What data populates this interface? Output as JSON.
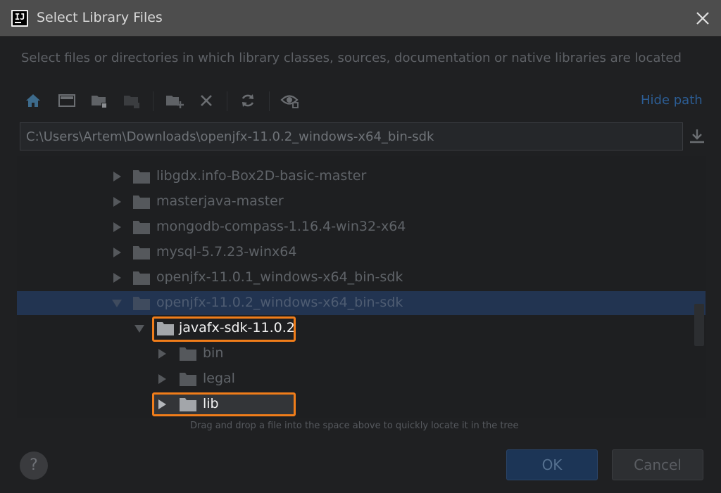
{
  "titlebar": {
    "title": "Select Library Files"
  },
  "description": "Select files or directories in which library classes, sources, documentation or native libraries are located",
  "toolbar": {
    "icons": [
      "home-icon",
      "desktop-icon",
      "project-folder-icon",
      "module-folder-icon",
      "new-folder-icon",
      "delete-icon",
      "refresh-icon",
      "show-hidden-icon"
    ],
    "hide_path_label": "Hide path"
  },
  "path": {
    "value": "C:\\Users\\Artem\\Downloads\\openjfx-11.0.2_windows-x64_bin-sdk"
  },
  "tree": {
    "items": [
      {
        "label": "libgdx.info-Box2D-basic-master",
        "level": 0,
        "expanded": false
      },
      {
        "label": "masterjava-master",
        "level": 0,
        "expanded": false
      },
      {
        "label": "mongodb-compass-1.16.4-win32-x64",
        "level": 0,
        "expanded": false
      },
      {
        "label": "mysql-5.7.23-winx64",
        "level": 0,
        "expanded": false
      },
      {
        "label": "openjfx-11.0.1_windows-x64_bin-sdk",
        "level": 0,
        "expanded": false
      },
      {
        "label": "openjfx-11.0.2_windows-x64_bin-sdk",
        "level": 0,
        "expanded": true,
        "selected": true
      },
      {
        "label": "javafx-sdk-11.0.2",
        "level": 1,
        "expanded": true,
        "highlighted": true
      },
      {
        "label": "bin",
        "level": 2,
        "expanded": false
      },
      {
        "label": "legal",
        "level": 2,
        "expanded": false
      },
      {
        "label": "lib",
        "level": 2,
        "expanded": false,
        "highlighted": true
      }
    ]
  },
  "hint": "Drag and drop a file into the space above to quickly locate it in the tree",
  "buttons": {
    "help": "?",
    "ok": "OK",
    "cancel": "Cancel"
  },
  "colors": {
    "accent": "#2c5d94",
    "highlight": "#f07d1a",
    "selection": "#223451"
  }
}
